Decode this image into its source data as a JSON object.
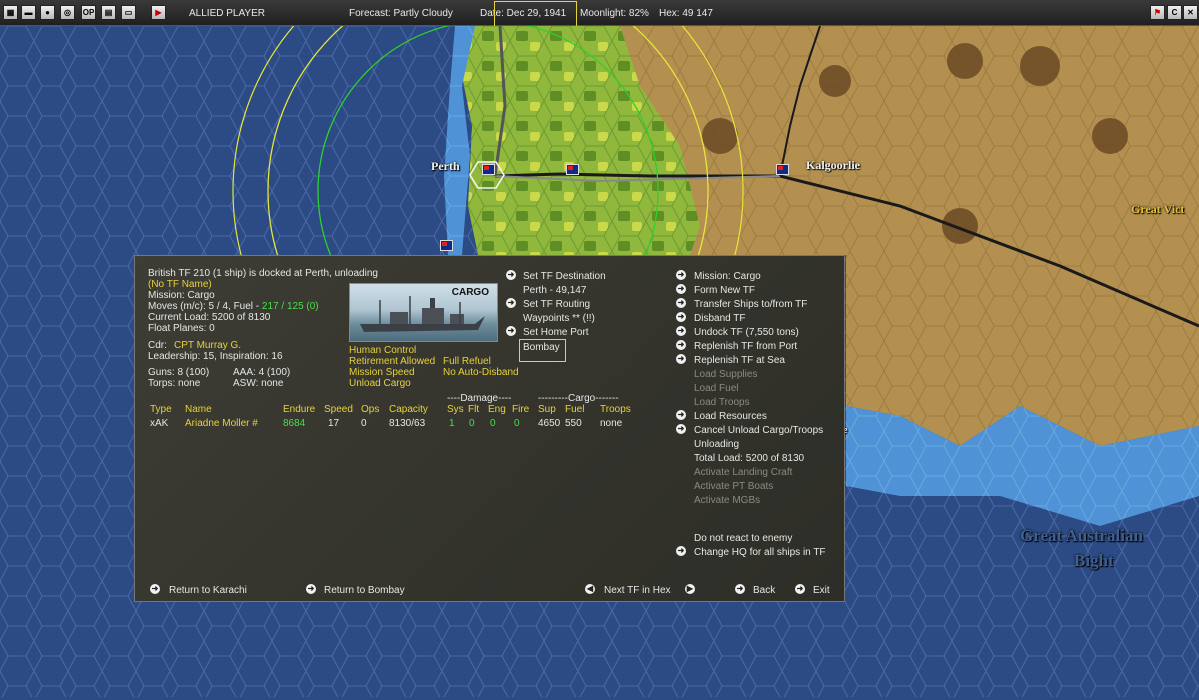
{
  "topbar": {
    "player": "ALLIED PLAYER",
    "forecast": "Forecast: Partly Cloudy",
    "date": "Date: Dec 29, 1941",
    "moonlight": "Moonlight: 82%",
    "hex": "Hex: 49 147",
    "buttons": [
      "OP",
      "C"
    ]
  },
  "map": {
    "perth": "Perth",
    "kalgoorlie": "Kalgoorlie",
    "great_victoria": "Great Vict",
    "gab_line1": "Great Australian",
    "gab_line2": "Bight",
    "fragment_e": "e"
  },
  "tf": {
    "header": "British TF 210 (1 ship) is docked at Perth, unloading",
    "no_name": "(No TF Name)",
    "mission": "Mission: Cargo",
    "moves_prefix": "Moves (m/c): 5 / 4, Fuel - ",
    "moves_fuel": "217 / 125 (0)",
    "current_load": "Current Load: 5200 of 8130",
    "float_planes": "Float Planes: 0",
    "cdr_prefix": "Cdr:",
    "cdr_name": "CPT Murray G.",
    "leadership": "Leadership: 15, Inspiration: 16",
    "guns": "Guns: 8 (100)",
    "aaa": "AAA: 4 (100)",
    "torps": "Torps: none",
    "asw": "ASW: none",
    "image_caption": "CARGO",
    "human_control": "Human Control",
    "retirement": "Retirement Allowed",
    "full_refuel": "Full Refuel",
    "mission_speed": "Mission Speed",
    "no_auto_disband": "No Auto-Disband",
    "unload_cargo": "Unload Cargo",
    "set_destination": "Set TF Destination",
    "destination_value": "Perth - 49,147",
    "set_routing": "Set TF Routing",
    "waypoints": "Waypoints ** (!!)",
    "set_home_port": "Set Home Port",
    "home_port_value": "Bombay"
  },
  "ship_table": {
    "damage_header": "----Damage----",
    "cargo_header": "---------Cargo-------",
    "columns": [
      "Type",
      "Name",
      "Endure",
      "Speed",
      "Ops",
      "Capacity",
      "Sys",
      "Flt",
      "Eng",
      "Fire",
      "Sup",
      "Fuel",
      "Troops"
    ],
    "rows": [
      [
        "xAK",
        "Ariadne Moller #",
        "8684",
        "17",
        "0",
        "8130/63",
        "1",
        "0",
        "0",
        "0",
        "4650",
        "550",
        "none"
      ]
    ]
  },
  "right_menu": {
    "mission": "Mission: Cargo",
    "form_new": "Form New TF",
    "transfer": "Transfer Ships to/from TF",
    "disband": "Disband TF",
    "undock": "Undock TF (7,550 tons)",
    "replenish_port": "Replenish TF from Port",
    "replenish_sea": "Replenish TF at Sea",
    "load_supplies": "Load Supplies",
    "load_fuel": "Load Fuel",
    "load_troops": "Load Troops",
    "load_resources": "Load Resources",
    "cancel_unload": "Cancel Unload Cargo/Troops",
    "unloading": "Unloading",
    "total_load": "Total Load: 5200 of 8130",
    "landing_craft": "Activate Landing Craft",
    "pt_boats": "Activate PT Boats",
    "mgbs": "Activate MGBs",
    "no_react": "Do not react to enemy",
    "change_hq": "Change HQ for all ships in TF"
  },
  "bottom": {
    "return_karachi": "Return to Karachi",
    "return_bombay": "Return to Bombay",
    "next_tf": "Next TF in Hex",
    "back": "Back",
    "exit": "Exit"
  },
  "colors": {
    "ocean": "#2c4a84",
    "land_green": "#8fb83c",
    "land_brown": "#b08a45",
    "highlight": "#e6d23a",
    "green_text": "#46e046"
  }
}
